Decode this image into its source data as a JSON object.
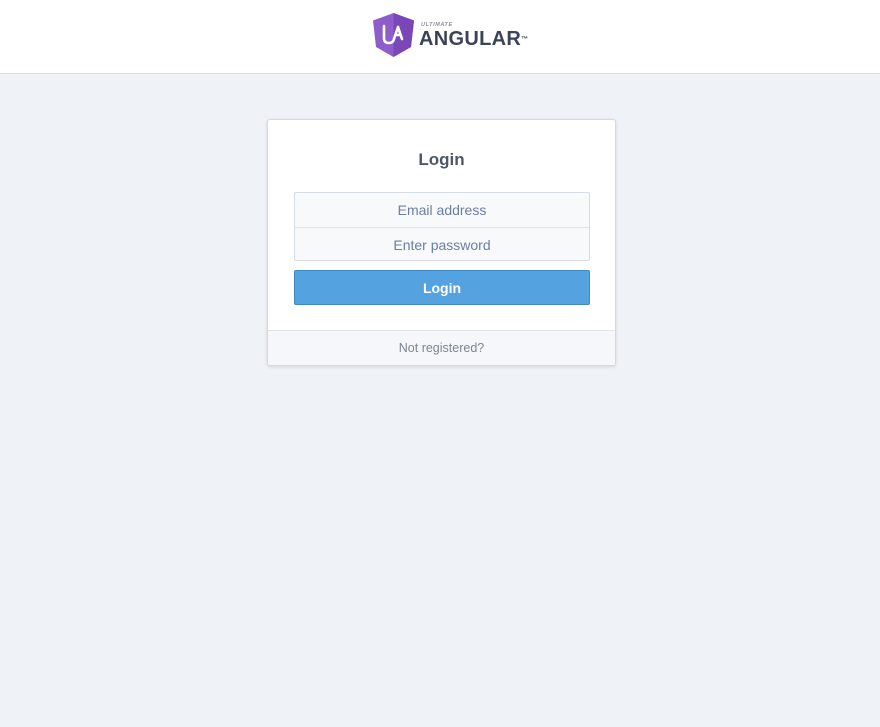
{
  "header": {
    "logo": {
      "mark_text": "UA",
      "small_text": "ULTIMATE",
      "big_text": "ANGULAR",
      "tm": "™",
      "color": "#8e5dcc"
    }
  },
  "login_card": {
    "title": "Login",
    "email_placeholder": "Email address",
    "password_placeholder": "Enter password",
    "submit_label": "Login",
    "footer_link": "Not registered?"
  },
  "colors": {
    "background": "#eff2f7",
    "primary_button": "#54a2e0"
  }
}
